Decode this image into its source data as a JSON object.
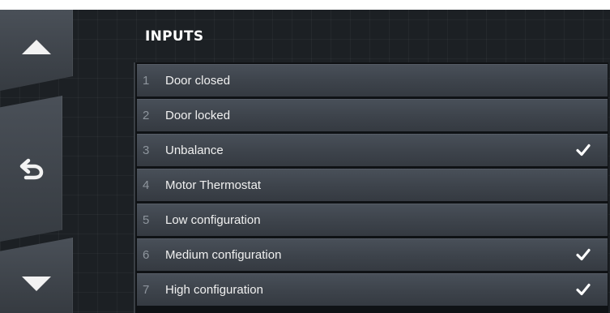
{
  "screen": {
    "title": "INPUTS"
  },
  "nav": {
    "up_icon": "triangle-up-icon",
    "back_icon": "return-arrow-icon",
    "down_icon": "triangle-down-icon"
  },
  "inputs": [
    {
      "number": "1",
      "label": "Door closed",
      "checked": false
    },
    {
      "number": "2",
      "label": "Door locked",
      "checked": false
    },
    {
      "number": "3",
      "label": "Unbalance",
      "checked": true
    },
    {
      "number": "4",
      "label": "Motor Thermostat",
      "checked": false
    },
    {
      "number": "5",
      "label": "Low configuration",
      "checked": false
    },
    {
      "number": "6",
      "label": "Medium configuration",
      "checked": true
    },
    {
      "number": "7",
      "label": "High configuration",
      "checked": true
    }
  ],
  "colors": {
    "background": "#1c2024",
    "row": "#40464e",
    "text": "#f0f0f0",
    "number": "#8e959d",
    "check": "#ffffff"
  }
}
